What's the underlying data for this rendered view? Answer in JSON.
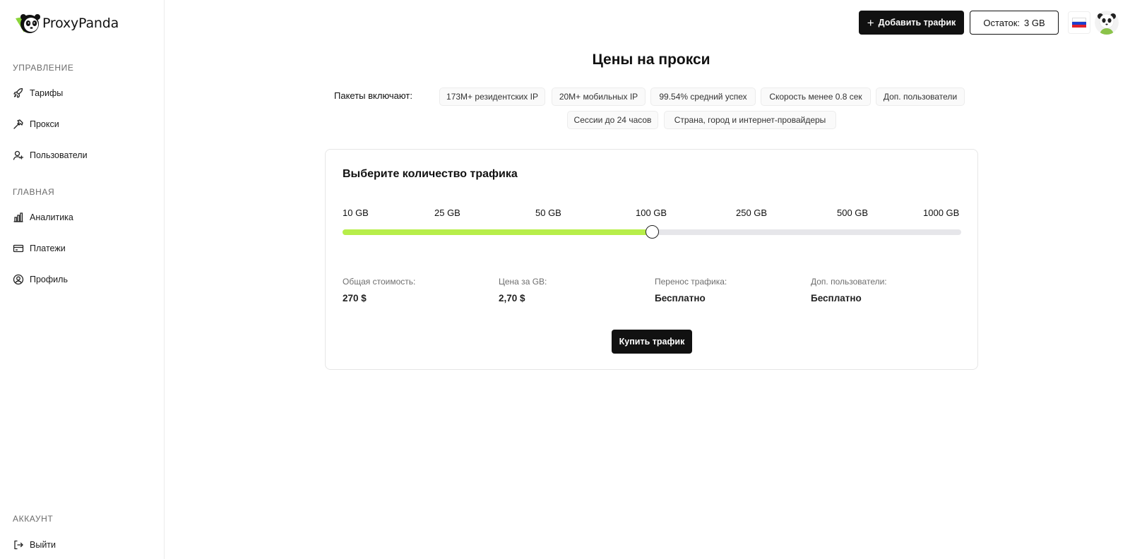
{
  "brand": {
    "name": "ProxyPanda"
  },
  "sidebar": {
    "sections": [
      {
        "label": "УПРАВЛЕНИЕ"
      },
      {
        "label": "ГЛАВНАЯ"
      },
      {
        "label": "АККАУНТ"
      }
    ],
    "items": [
      {
        "label": "Тарифы",
        "icon": "rocket-icon"
      },
      {
        "label": "Прокси",
        "icon": "hammer-icon"
      },
      {
        "label": "Пользователи",
        "icon": "user-plus-icon"
      },
      {
        "label": "Аналитика",
        "icon": "bar-chart-icon"
      },
      {
        "label": "Платежи",
        "icon": "credit-card-icon"
      },
      {
        "label": "Профиль",
        "icon": "user-circle-icon"
      },
      {
        "label": "Выйти",
        "icon": "logout-icon"
      }
    ]
  },
  "header": {
    "add_traffic_label": "Добавить трафик",
    "balance_label": "Остаток:",
    "balance_value": "3 GB",
    "language_icon": "russian-flag-icon",
    "avatar_icon": "panda-avatar-icon"
  },
  "main": {
    "title": "Цены на прокси",
    "includes_label": "Пакеты включают:",
    "features": [
      "173M+ резидентских IP",
      "20M+ мобильных IP",
      "99.54% средний успех",
      "Скорость менее 0.8 сек",
      "Доп. пользователи",
      "Сессии до 24 часов",
      "Страна, город и интернет-провайдеры"
    ]
  },
  "traffic_card": {
    "title": "Выберите количество трафика",
    "options": [
      "10 GB",
      "25 GB",
      "50 GB",
      "100 GB",
      "250 GB",
      "500 GB",
      "1000 GB"
    ],
    "selected": "100 GB",
    "stats": [
      {
        "label": "Общая стоимость:",
        "value": "270 $"
      },
      {
        "label": "Цена за GB:",
        "value": "2,70 $"
      },
      {
        "label": "Перенос трафика:",
        "value": "Бесплатно"
      },
      {
        "label": "Доп. пользователи:",
        "value": "Бесплатно"
      }
    ],
    "buy_label": "Купить трафик"
  },
  "colors": {
    "accent": "#b7ee4a",
    "dark": "#111111",
    "track": "#e6e6ea"
  }
}
